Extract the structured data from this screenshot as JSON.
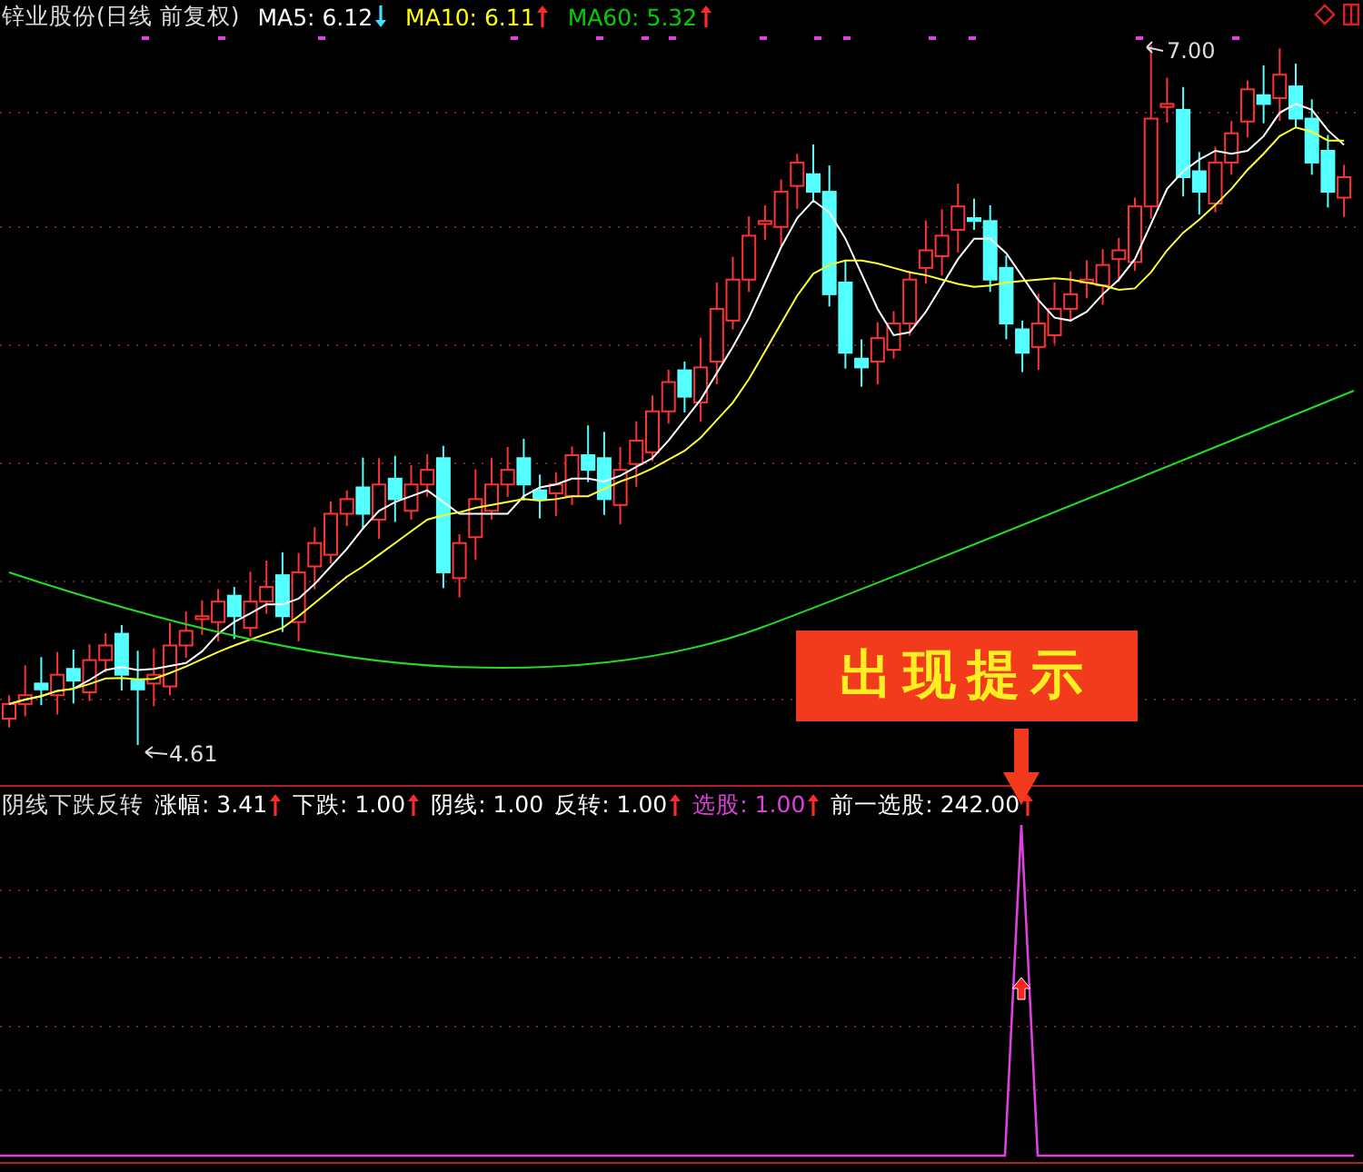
{
  "header": {
    "title": "锌业股份(日线 前复权)",
    "indicators": [
      {
        "label": "MA5: 6.12",
        "color": "#ffffff",
        "arrow_up": false,
        "arrow_down": true
      },
      {
        "label": "MA10: 6.11",
        "color": "#ffff00",
        "arrow_up": true,
        "arrow_down": false
      },
      {
        "label": "MA60: 5.32",
        "color": "#00d000",
        "arrow_up": true,
        "arrow_down": false
      }
    ]
  },
  "price_chart": {
    "high_label": "7.00",
    "low_label": "4.61"
  },
  "callout": {
    "text": "出现提示"
  },
  "indicator_panel": {
    "title": "阴线下跌反转",
    "values": [
      {
        "label": "涨幅: 3.41",
        "color": "#ffffff",
        "arrow_up": true,
        "arrow_down": false
      },
      {
        "label": "下跌: 1.00",
        "color": "#ffffff",
        "arrow_up": true,
        "arrow_down": false
      },
      {
        "label": "阴线: 1.00",
        "color": "#ffffff",
        "arrow_up": false,
        "arrow_down": false
      },
      {
        "label": "反转: 1.00",
        "color": "#ffffff",
        "arrow_up": true,
        "arrow_down": false
      },
      {
        "label": "选股: 1.00",
        "color": "#e040e0",
        "arrow_up": true,
        "arrow_down": false
      },
      {
        "label": "前一选股: 242.00",
        "color": "#ffffff",
        "arrow_up": true,
        "arrow_down": false
      }
    ]
  }
}
